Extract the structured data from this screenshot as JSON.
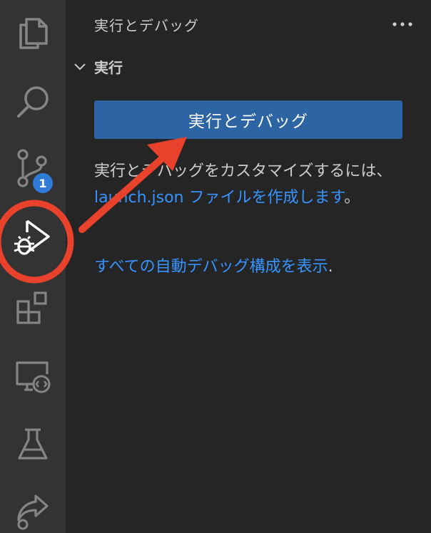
{
  "activity_bar": {
    "items": [
      {
        "icon": "files-icon"
      },
      {
        "icon": "search-icon"
      },
      {
        "icon": "source-control-icon",
        "badge": "1"
      },
      {
        "icon": "run-debug-icon",
        "active": true
      },
      {
        "icon": "extensions-icon"
      },
      {
        "icon": "remote-explorer-icon"
      },
      {
        "icon": "testing-icon"
      },
      {
        "icon": "live-share-icon"
      }
    ]
  },
  "sidebar": {
    "title": "実行とデバッグ",
    "more_label": "···",
    "section": {
      "title": "実行",
      "run_button": "実行とデバッグ",
      "desc_prefix": "実行とデバッグをカスタマイズするには、",
      "desc_link": "launch.json ファイルを作成します",
      "desc_suffix": "。",
      "show_all_link": "すべての自動デバッグ構成を表示",
      "show_all_suffix": "."
    }
  },
  "colors": {
    "activity_bg": "#333333",
    "sidebar_bg": "#252526",
    "button_bg": "#2d64a3",
    "link": "#3794ff",
    "badge": "#2f7bd6",
    "annotation": "#e8412c"
  }
}
